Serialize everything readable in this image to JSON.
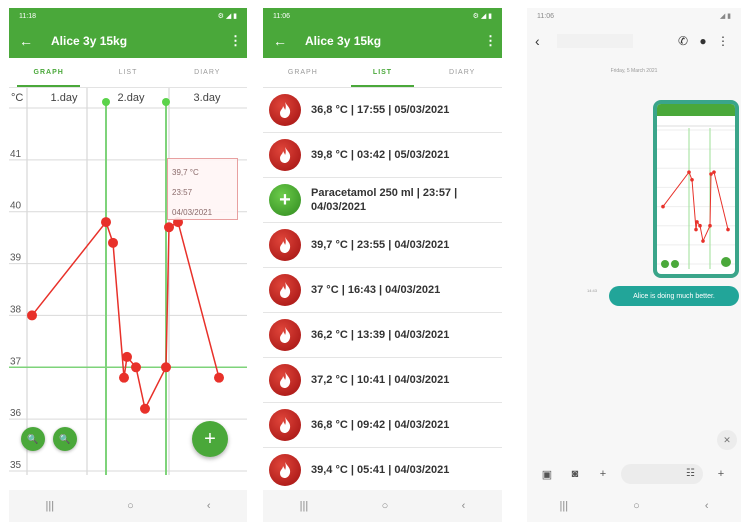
{
  "graph_screen": {
    "status_time": "11:18",
    "status_icons": "⚙ ◢ ▮",
    "title": "Alice 3y 15kg",
    "back_icon": "←",
    "menu_icon": "⋮",
    "tabs": [
      {
        "label": "GRAPH",
        "active": true
      },
      {
        "label": "LIST",
        "active": false
      },
      {
        "label": "DIARY",
        "active": false
      }
    ],
    "chart_data": {
      "type": "line",
      "ylabel": "°C",
      "ylim": [
        35,
        42
      ],
      "y_ticks": [
        "41",
        "40",
        "39",
        "38",
        "37",
        "36",
        "35"
      ],
      "day_labels": [
        "1.day",
        "2.day",
        "3.day"
      ],
      "points_y": [
        38.0,
        39.8,
        39.4,
        36.8,
        37.2,
        37.0,
        36.2,
        37.0,
        39.7,
        39.8,
        36.8
      ],
      "reference_line": 37.0,
      "series": [
        {
          "color": "#e8312a"
        }
      ]
    },
    "tooltip": {
      "line1": "39,7 °C",
      "line2": "23:57",
      "line3": "04/03/2021"
    },
    "zoom_in_icon": "🔍",
    "zoom_out_icon": "🔍",
    "add_icon": "+",
    "nav": [
      "|||",
      "○",
      "‹"
    ]
  },
  "list_screen": {
    "status_time": "11:06",
    "status_icons": "⚙ ◢ ▮",
    "title": "Alice 3y 15kg",
    "back_icon": "←",
    "menu_icon": "⋮",
    "tabs": [
      {
        "label": "GRAPH",
        "active": false
      },
      {
        "label": "LIST",
        "active": true
      },
      {
        "label": "DIARY",
        "active": false
      }
    ],
    "rows": [
      {
        "type": "temp",
        "text": "36,8 °C | 17:55 | 05/03/2021"
      },
      {
        "type": "temp",
        "text": "39,8 °C | 03:42 | 05/03/2021"
      },
      {
        "type": "med",
        "text": "Paracetamol 250 ml | 23:57 | 04/03/2021"
      },
      {
        "type": "temp",
        "text": "39,7 °C | 23:55 | 04/03/2021"
      },
      {
        "type": "temp",
        "text": "37 °C | 16:43 | 04/03/2021"
      },
      {
        "type": "temp",
        "text": "36,2 °C | 13:39 | 04/03/2021"
      },
      {
        "type": "temp",
        "text": "37,2 °C | 10:41 | 04/03/2021"
      },
      {
        "type": "temp",
        "text": "36,8 °C | 09:42 | 04/03/2021"
      },
      {
        "type": "temp",
        "text": "39,4 °C | 05:41 | 04/03/2021"
      }
    ],
    "nav": [
      "|||",
      "○",
      "‹"
    ]
  },
  "chat_screen": {
    "status_time": "11:06",
    "status_icons": "◢ ▮",
    "back_icon": "‹",
    "phone_icon": "✆",
    "video_icon": "●",
    "menu_icon": "⋮",
    "date_label": "Friday, 5 March 2021",
    "message_text": "Alice is doing much better.",
    "message_time": "14:43",
    "close_icon": "✕",
    "composer_icons": {
      "gallery": "▣",
      "camera": "◙",
      "add": "+",
      "sticker": "☷",
      "send": "+"
    },
    "nav": [
      "|||",
      "○",
      "‹"
    ]
  }
}
